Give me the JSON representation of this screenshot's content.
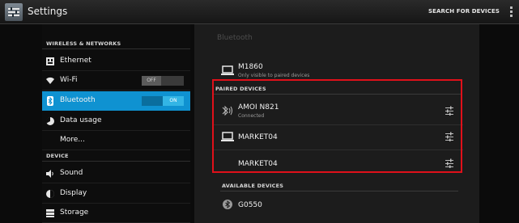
{
  "app": {
    "title": "Settings",
    "search_label": "SEARCH FOR DEVICES"
  },
  "sidebar": {
    "section_wireless": "WIRELESS & NETWORKS",
    "section_device": "DEVICE",
    "items": [
      {
        "label": "Ethernet",
        "icon": "ethernet-icon"
      },
      {
        "label": "Wi-Fi",
        "icon": "wifi-icon",
        "toggle": "OFF"
      },
      {
        "label": "Bluetooth",
        "icon": "bluetooth-icon",
        "toggle": "ON",
        "selected": true
      },
      {
        "label": "Data usage",
        "icon": "data-usage-icon"
      },
      {
        "label": "More..."
      },
      {
        "label": "Sound",
        "icon": "sound-icon"
      },
      {
        "label": "Display",
        "icon": "display-icon"
      },
      {
        "label": "Storage",
        "icon": "storage-icon"
      }
    ]
  },
  "bluetooth": {
    "title": "Bluetooth",
    "this_device": {
      "name": "M1860",
      "status": "Only visible to paired devices",
      "icon": "laptop-icon"
    },
    "paired_header": "PAIRED DEVICES",
    "paired": [
      {
        "name": "AMOI N821",
        "status": "Connected",
        "icon": "bluetooth-audio-icon"
      },
      {
        "name": "MARKET04",
        "icon": "laptop-icon"
      },
      {
        "name": "MARKET04"
      }
    ],
    "available_header": "AVAILABLE DEVICES",
    "available": [
      {
        "name": "G0550",
        "icon": "bluetooth-device-icon"
      }
    ]
  },
  "colors": {
    "accent": "#33b5e5",
    "selected": "#0f92d1",
    "highlight": "#e0101a"
  }
}
